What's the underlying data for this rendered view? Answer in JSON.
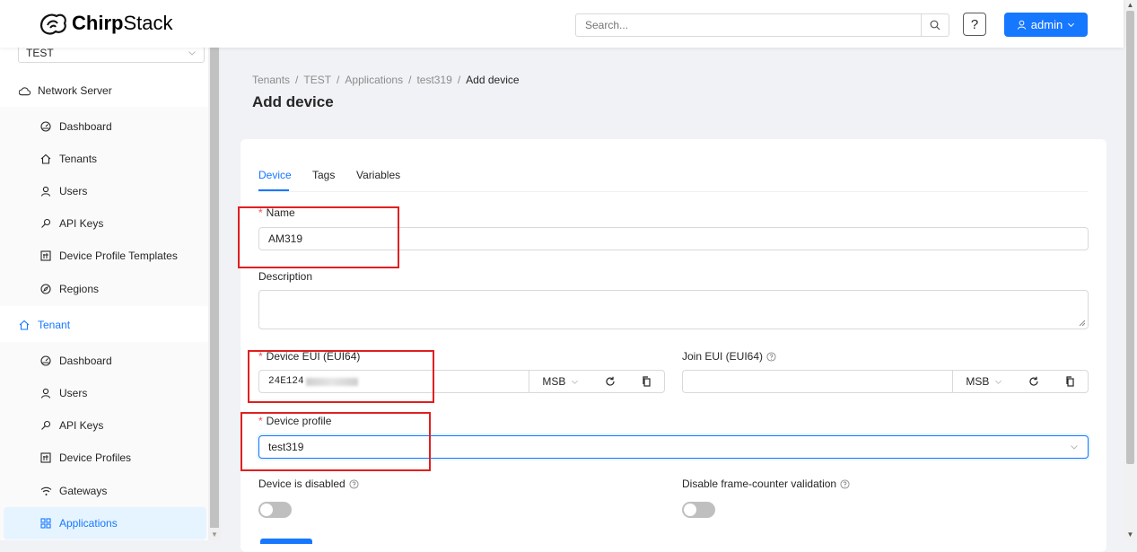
{
  "header": {
    "brand_bold": "Chirp",
    "brand_rest": "Stack",
    "search_placeholder": "Search...",
    "help_label": "?",
    "user_label": "admin"
  },
  "sidebar": {
    "tenant_select": "TEST",
    "network_server": {
      "title": "Network Server",
      "items": [
        {
          "label": "Dashboard",
          "icon": "dashboard-icon"
        },
        {
          "label": "Tenants",
          "icon": "home-icon"
        },
        {
          "label": "Users",
          "icon": "user-icon"
        },
        {
          "label": "API Keys",
          "icon": "key-icon"
        },
        {
          "label": "Device Profile Templates",
          "icon": "profile-icon"
        },
        {
          "label": "Regions",
          "icon": "compass-icon"
        }
      ]
    },
    "tenant": {
      "title": "Tenant",
      "items": [
        {
          "label": "Dashboard",
          "icon": "dashboard-icon"
        },
        {
          "label": "Users",
          "icon": "user-icon"
        },
        {
          "label": "API Keys",
          "icon": "key-icon"
        },
        {
          "label": "Device Profiles",
          "icon": "profile-icon"
        },
        {
          "label": "Gateways",
          "icon": "wifi-icon"
        },
        {
          "label": "Applications",
          "icon": "apps-icon"
        }
      ]
    }
  },
  "breadcrumb": [
    "Tenants",
    "TEST",
    "Applications",
    "test319",
    "Add device"
  ],
  "page_title": "Add device",
  "tabs": [
    "Device",
    "Tags",
    "Variables"
  ],
  "form": {
    "name_label": "Name",
    "name_value": "AM319",
    "description_label": "Description",
    "description_value": "",
    "dev_eui_label": "Device EUI (EUI64)",
    "dev_eui_value": "24E124",
    "join_eui_label": "Join EUI (EUI64)",
    "join_eui_value": "",
    "byte_order": "MSB",
    "device_profile_label": "Device profile",
    "device_profile_value": "test319",
    "disabled_label": "Device is disabled",
    "disable_fcnt_label": "Disable frame-counter validation"
  },
  "colors": {
    "primary": "#1677ff",
    "required": "#ff4d4f",
    "highlight_box": "#e02020"
  }
}
